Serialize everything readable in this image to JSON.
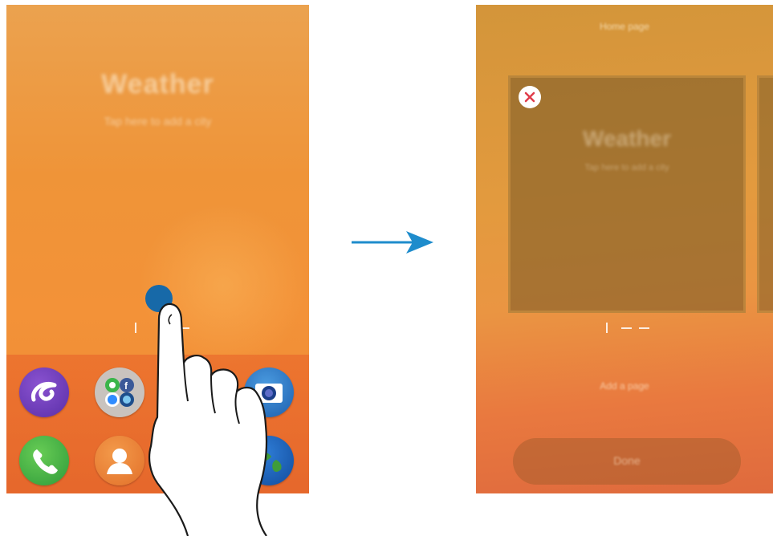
{
  "left_screen": {
    "widget_title": "Weather",
    "widget_subtitle": "Tap here to add a city",
    "dock_apps": [
      {
        "name": "galaxy-apps-icon"
      },
      {
        "name": "app-folder-icon",
        "contains": [
          "whatsapp-icon",
          "facebook-icon",
          "messenger-icon",
          "browser-icon"
        ]
      },
      {
        "name": "camera-icon"
      },
      {
        "name": "phone-icon"
      },
      {
        "name": "contacts-icon"
      },
      {
        "name": "internet-icon"
      }
    ]
  },
  "right_screen": {
    "page_title": "Home page",
    "card_title": "Weather",
    "card_subtitle": "Tap here to add a city",
    "link_label": "Add a page",
    "button_label": "Done"
  },
  "colors": {
    "arrow": "#1e8ccc",
    "touch_point": "#1769a8",
    "remove_x": "#e03c4a"
  }
}
